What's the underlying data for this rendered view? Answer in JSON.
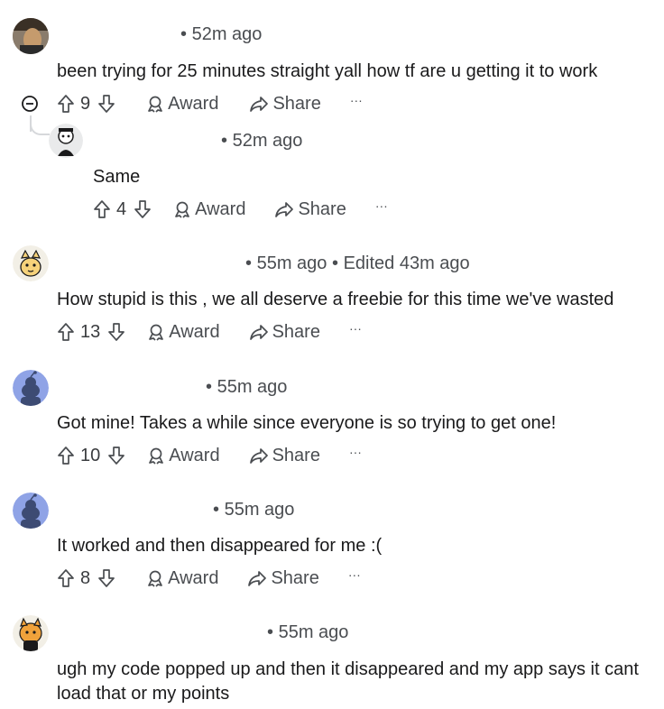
{
  "comments": [
    {
      "author": "",
      "time": "52m ago",
      "edited": "",
      "body": "been trying for 25 minutes straight yall how tf are u getting it to work",
      "score": "9",
      "award": "Award",
      "share": "Share",
      "more": "···"
    },
    {
      "author": "",
      "time": "52m ago",
      "edited": "",
      "body": "Same",
      "score": "4",
      "award": "Award",
      "share": "Share",
      "more": "···"
    },
    {
      "author": "",
      "time": "55m ago",
      "edited": "Edited 43m ago",
      "body": "How stupid is this , we all deserve a freebie for this time we've wasted",
      "score": "13",
      "award": "Award",
      "share": "Share",
      "more": "···"
    },
    {
      "author": "",
      "time": "55m ago",
      "edited": "",
      "body": "Got mine! Takes a while since everyone is so trying to get one!",
      "score": "10",
      "award": "Award",
      "share": "Share",
      "more": "···"
    },
    {
      "author": "",
      "time": "55m ago",
      "edited": "",
      "body": "It worked and then disappeared for me :(",
      "score": "8",
      "award": "Award",
      "share": "Share",
      "more": "···"
    },
    {
      "author": "",
      "time": "55m ago",
      "edited": "",
      "body": "ugh my code popped up and then it disappeared and my app says it cant load that or my points",
      "score": "",
      "award": "",
      "share": "",
      "more": ""
    }
  ],
  "icons": {
    "collapse": "collapse-icon",
    "upvote": "upvote-icon",
    "downvote": "downvote-icon",
    "award": "award-icon",
    "share": "share-icon"
  }
}
